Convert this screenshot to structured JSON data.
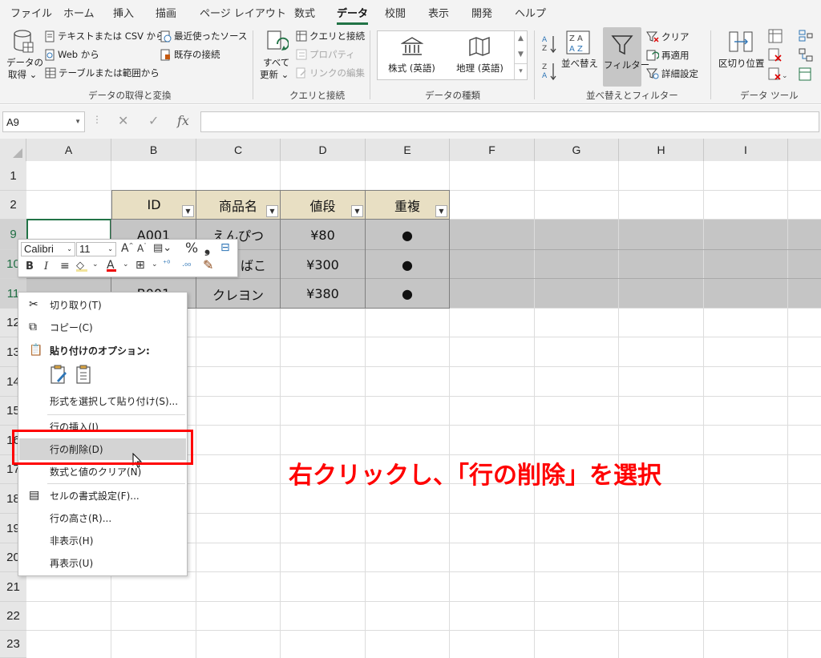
{
  "menubar": {
    "items": [
      "ファイル",
      "ホーム",
      "挿入",
      "描画",
      "ページ レイアウト",
      "数式",
      "データ",
      "校閲",
      "表示",
      "開発",
      "ヘルプ"
    ],
    "active_index": 6
  },
  "ribbon": {
    "get_data": {
      "line1": "データの",
      "line2": "取得 ⌄"
    },
    "from_text_csv": "テキストまたは CSV から",
    "from_web": "Web から",
    "from_table": "テーブルまたは範囲から",
    "recent_sources": "最近使ったソース",
    "existing_connections": "既存の接続",
    "group_get_transform": "データの取得と変換",
    "refresh_all": {
      "line1": "すべて",
      "line2": "更新 ⌄"
    },
    "queries_connections": "クエリと接続",
    "properties": "プロパティ",
    "edit_links": "リンクの編集",
    "group_queries": "クエリと接続",
    "stocks": "株式 (英語)",
    "geography": "地理 (英語)",
    "group_data_types": "データの種類",
    "sort": "並べ替え",
    "filter": "フィルター",
    "clear": "クリア",
    "reapply": "再適用",
    "advanced": "詳細設定",
    "group_sort_filter": "並べ替えとフィルター",
    "text_to_columns": "区切り位置",
    "group_data_tools": "データ ツール"
  },
  "formulabar": {
    "namebox": "A9",
    "cancel": "✕",
    "enter": "✓",
    "fx": "fx",
    "value": ""
  },
  "grid": {
    "columns": [
      "A",
      "B",
      "C",
      "D",
      "E",
      "F",
      "G",
      "H",
      "I"
    ],
    "rows": [
      "1",
      "2",
      "9",
      "10",
      "11",
      "12",
      "13",
      "14",
      "15",
      "16",
      "17",
      "18",
      "19",
      "20",
      "21",
      "22",
      "23"
    ],
    "table_headers": [
      "ID",
      "商品名",
      "値段",
      "重複"
    ],
    "table_rows": [
      [
        "A001",
        "えんぴつ",
        "¥80",
        "●"
      ],
      [
        "",
        "ばこ",
        "¥300",
        "●"
      ],
      [
        "B001",
        "クレヨン",
        "¥380",
        "●"
      ]
    ]
  },
  "minibar": {
    "font": "Calibri",
    "size": "11"
  },
  "context_menu": {
    "items": [
      {
        "label": "切り取り(T)",
        "icon": "scissors-icon"
      },
      {
        "label": "コピー(C)",
        "icon": "copy-icon"
      },
      {
        "label": "貼り付けのオプション:",
        "icon": "clipboard-icon"
      },
      {
        "label": "形式を選択して貼り付け(S)...",
        "icon": ""
      },
      {
        "label": "行の挿入(I)",
        "icon": ""
      },
      {
        "label": "行の削除(D)",
        "icon": ""
      },
      {
        "label": "数式と値のクリア(N)",
        "icon": ""
      },
      {
        "label": "セルの書式設定(F)...",
        "icon": "format-cells-icon"
      },
      {
        "label": "行の高さ(R)...",
        "icon": ""
      },
      {
        "label": "非表示(H)",
        "icon": ""
      },
      {
        "label": "再表示(U)",
        "icon": ""
      }
    ]
  },
  "annotation": "右クリックし、「行の削除」を選択",
  "colors": {
    "accent": "#217346",
    "header_fill": "#e8dfc3",
    "selection": "#c5c5c5",
    "annotation": "#ff0000"
  }
}
